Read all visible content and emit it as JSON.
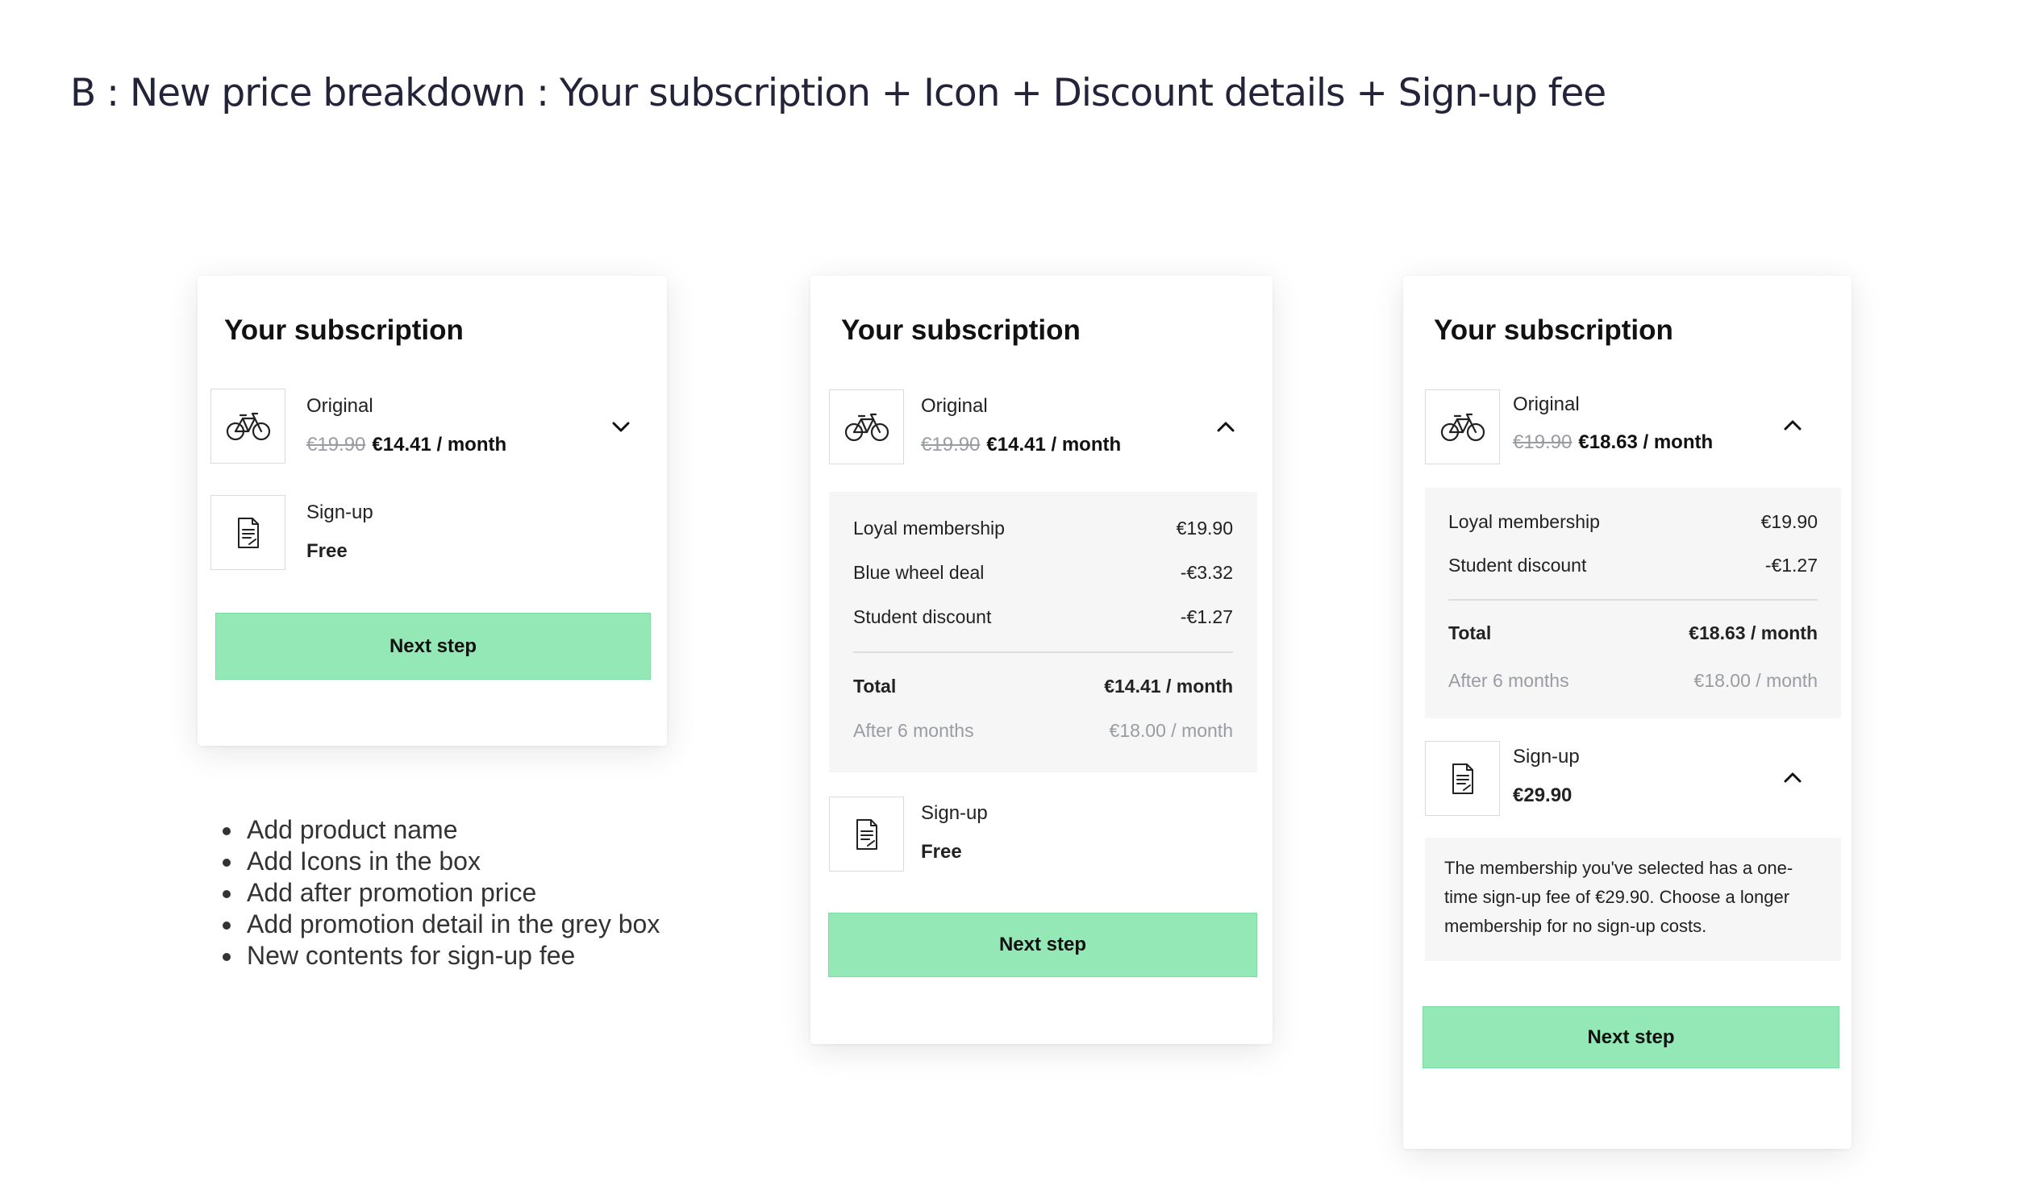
{
  "page_title": "B : New price breakdown : Your subscription + Icon + Discount details + Sign-up fee",
  "notes": [
    "Add product name",
    "Add Icons in the box",
    "Add after promotion price",
    "Add promotion detail in the grey box",
    "New contents for sign-up fee"
  ],
  "card_a": {
    "title": "Your subscription",
    "product_label": "Original",
    "old_price": "€19.90",
    "new_price": "€14.41 / month",
    "signup_label": "Sign-up",
    "signup_value": "Free",
    "button": "Next step"
  },
  "card_b": {
    "title": "Your subscription",
    "product_label": "Original",
    "old_price": "€19.90",
    "new_price": "€14.41 / month",
    "breakdown": [
      {
        "label": "Loyal membership",
        "value": "€19.90"
      },
      {
        "label": "Blue wheel deal",
        "value": "-€3.32"
      },
      {
        "label": "Student discount",
        "value": "-€1.27"
      }
    ],
    "total_label": "Total",
    "total_value": "€14.41 / month",
    "after_label": "After 6 months",
    "after_value": "€18.00 / month",
    "signup_label": "Sign-up",
    "signup_value": "Free",
    "button": "Next step"
  },
  "card_c": {
    "title": "Your subscription",
    "product_label": "Original",
    "old_price": "€19.90",
    "new_price": "€18.63 / month",
    "breakdown": [
      {
        "label": "Loyal membership",
        "value": "€19.90"
      },
      {
        "label": "Student discount",
        "value": "-€1.27"
      }
    ],
    "total_label": "Total",
    "total_value": "€18.63 / month",
    "after_label": "After 6 months",
    "after_value": "€18.00 / month",
    "signup_label": "Sign-up",
    "signup_value": "€29.90",
    "signup_note": "The membership you've selected has a one-time sign-up fee of €29.90. Choose a longer membership for no sign-up costs.",
    "button": "Next step"
  },
  "icons": {
    "product": "bicycle-icon",
    "signup": "document-icon",
    "collapsed": "chevron-down-icon",
    "expanded": "chevron-up-icon"
  },
  "colors": {
    "button": "#93e8b5",
    "grey_box": "#f6f6f7",
    "muted_text": "#9a9ca3"
  }
}
